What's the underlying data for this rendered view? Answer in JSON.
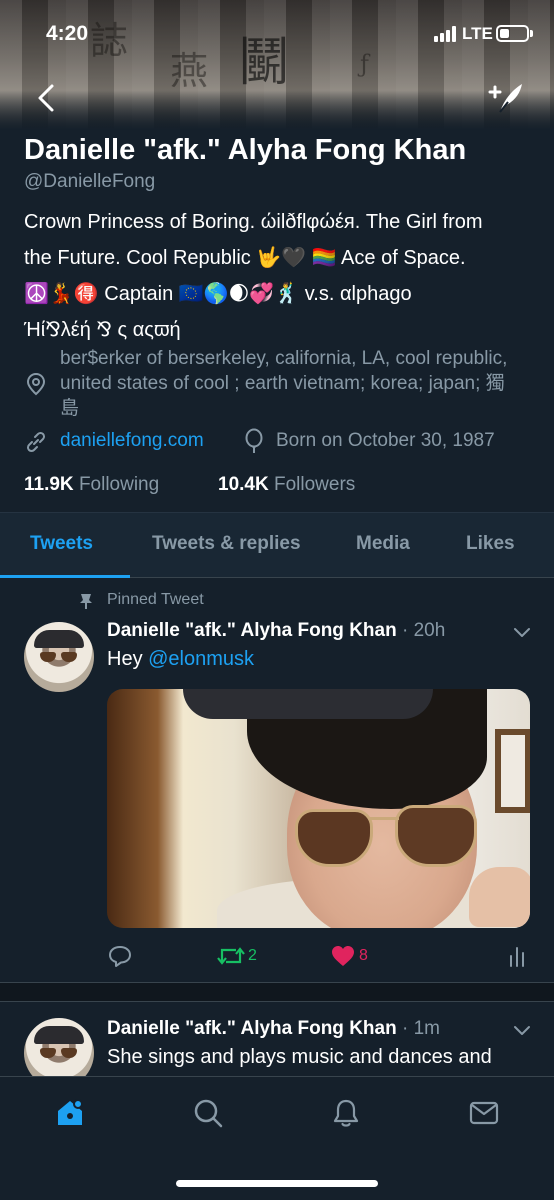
{
  "status_bar": {
    "time": "4:20",
    "network": "LTE"
  },
  "header": {
    "back_icon": "back-arrow-icon",
    "compose_icon": "compose-tweet-icon"
  },
  "profile": {
    "name": "Danielle \"afk.\" Alyha Fong Khan",
    "handle": "@DanielleFong",
    "bio_lines": [
      "Crown Princess of Boring. ώilðflφώέя. The Girl from",
      "the Future. Cool Republic 🤟🖤 🏳️‍🌈 Ace of Space.",
      "☮️💃🉐 Captain 🇪🇺🌎🌒💞🕺 v.s. αlphago",
      "Ήί⅋λέή ⅋ ς αςϖή"
    ],
    "location": "ber$erker of berserkeley, california, LA, cool republic, united states of cool ; earth vietnam; korea; japan; 獨島",
    "website": "daniellefong.com",
    "birthday": "Born on October 30, 1987",
    "following_count": "11.9K",
    "following_label": "Following",
    "followers_count": "10.4K",
    "followers_label": "Followers"
  },
  "tabs": [
    {
      "label": "Tweets",
      "active": true
    },
    {
      "label": "Tweets & replies",
      "active": false
    },
    {
      "label": "Media",
      "active": false
    },
    {
      "label": "Likes",
      "active": false
    }
  ],
  "tweets": [
    {
      "pinned_label": "Pinned Tweet",
      "author": "Danielle \"afk.\" Alyha Fong Khan",
      "time": "· 20h",
      "text_prefix": "Hey ",
      "mention": "@elonmusk",
      "retweet_count": "2",
      "like_count": "8"
    },
    {
      "author": "Danielle \"afk.\" Alyha Fong Khan",
      "time": "· 1m",
      "text": "She sings and plays music and dances and"
    }
  ],
  "colors": {
    "background": "#15202b",
    "accent": "#1da1f2",
    "secondary_text": "#8899a6",
    "retweet": "#17bf63",
    "like": "#e0245e"
  },
  "bottom_nav": [
    {
      "icon": "home-icon",
      "active": true
    },
    {
      "icon": "search-icon",
      "active": false
    },
    {
      "icon": "notifications-bell-icon",
      "active": false
    },
    {
      "icon": "messages-envelope-icon",
      "active": false
    }
  ]
}
